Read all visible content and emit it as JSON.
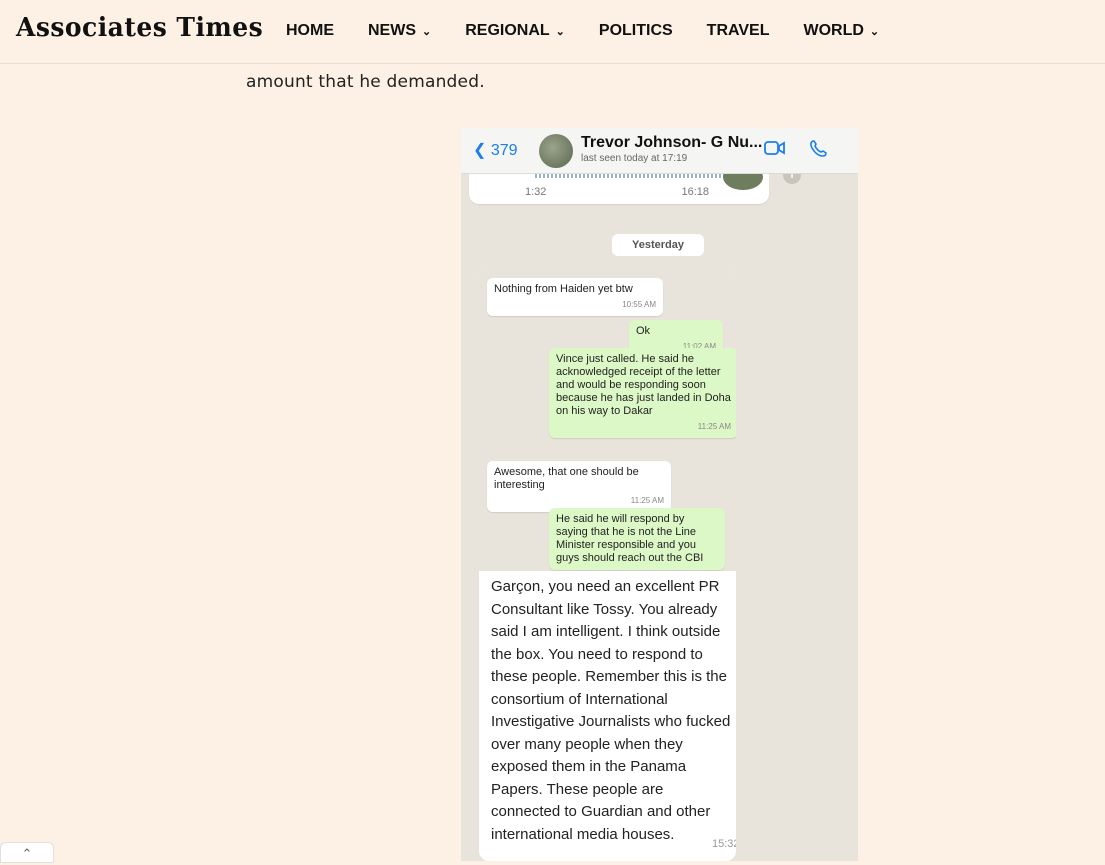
{
  "site": {
    "logo": "Associates Times"
  },
  "nav": [
    {
      "label": "HOME",
      "has_dropdown": false
    },
    {
      "label": "NEWS",
      "has_dropdown": true
    },
    {
      "label": "REGIONAL",
      "has_dropdown": true
    },
    {
      "label": "POLITICS",
      "has_dropdown": false
    },
    {
      "label": "TRAVEL",
      "has_dropdown": false
    },
    {
      "label": "WORLD",
      "has_dropdown": true
    }
  ],
  "article": {
    "intro_text": "amount that he demanded."
  },
  "whatsapp": {
    "back_count": "379",
    "contact_name": "Trevor  Johnson- G Nu...",
    "last_seen": "last seen today at 17:19",
    "audio_message": {
      "duration": "1:32",
      "time": "16:18"
    },
    "day_label": "Yesterday",
    "messages": [
      {
        "dir": "in",
        "text": "Nothing from Haiden yet btw",
        "time": "10:55 AM"
      },
      {
        "dir": "out",
        "text": "Ok",
        "time": "11:02 AM"
      },
      {
        "dir": "out",
        "text": "Vince just called. He said he acknowledged receipt of the letter and would be responding soon because he has just landed in Doha on his way to Dakar",
        "time": "11:25 AM"
      },
      {
        "dir": "in",
        "text": "Awesome, that one should be interesting",
        "time": "11:25 AM"
      },
      {
        "dir": "out",
        "text": "He said he will respond by saying that he is not the Line Minister responsible and you guys should reach out the CBI",
        "time": ""
      }
    ],
    "caption": "Garçon, you need an excellent PR Consultant like Tossy. You already said I am intelligent. I think outside the box. You need to respond to these people. Remember this is the consortium of International Investigative Journalists who fucked over many people when they exposed them in the Panama Papers. These people are connected to Guardian and other international media houses.",
    "caption_time": "15:32"
  },
  "ui": {
    "scroll_top_icon": "chevron-up-icon",
    "accent": "#1b7ef0",
    "outgoing_bubble": "#dcf8c6"
  }
}
